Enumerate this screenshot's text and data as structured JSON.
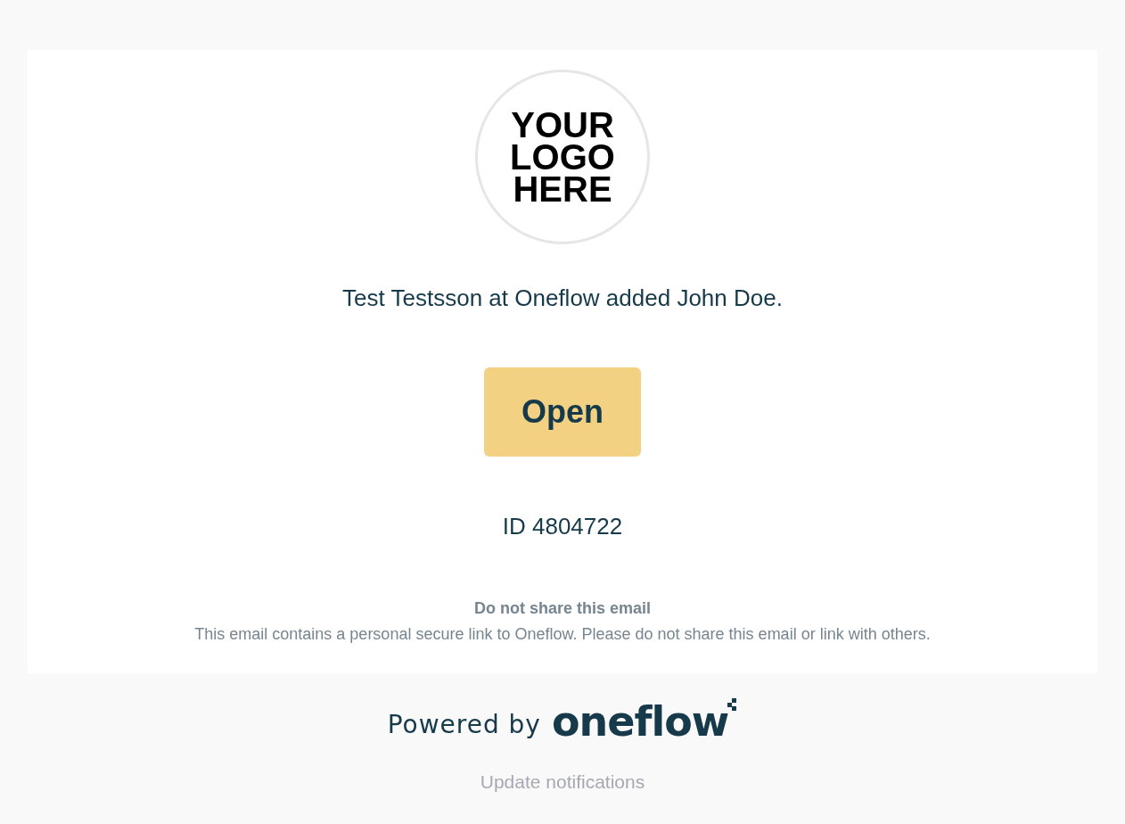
{
  "logo": {
    "text": "YOUR LOGO HERE"
  },
  "message": "Test Testsson at Oneflow added John Doe.",
  "button": {
    "label": "Open"
  },
  "id_text": "ID 4804722",
  "notice": {
    "title": "Do not share this email",
    "body": "This email contains a personal secure link to Oneflow. Please do not share this email or link with others."
  },
  "footer": {
    "powered_by": "Powered by",
    "brand": "oneflow",
    "link": "Update notifications"
  }
}
